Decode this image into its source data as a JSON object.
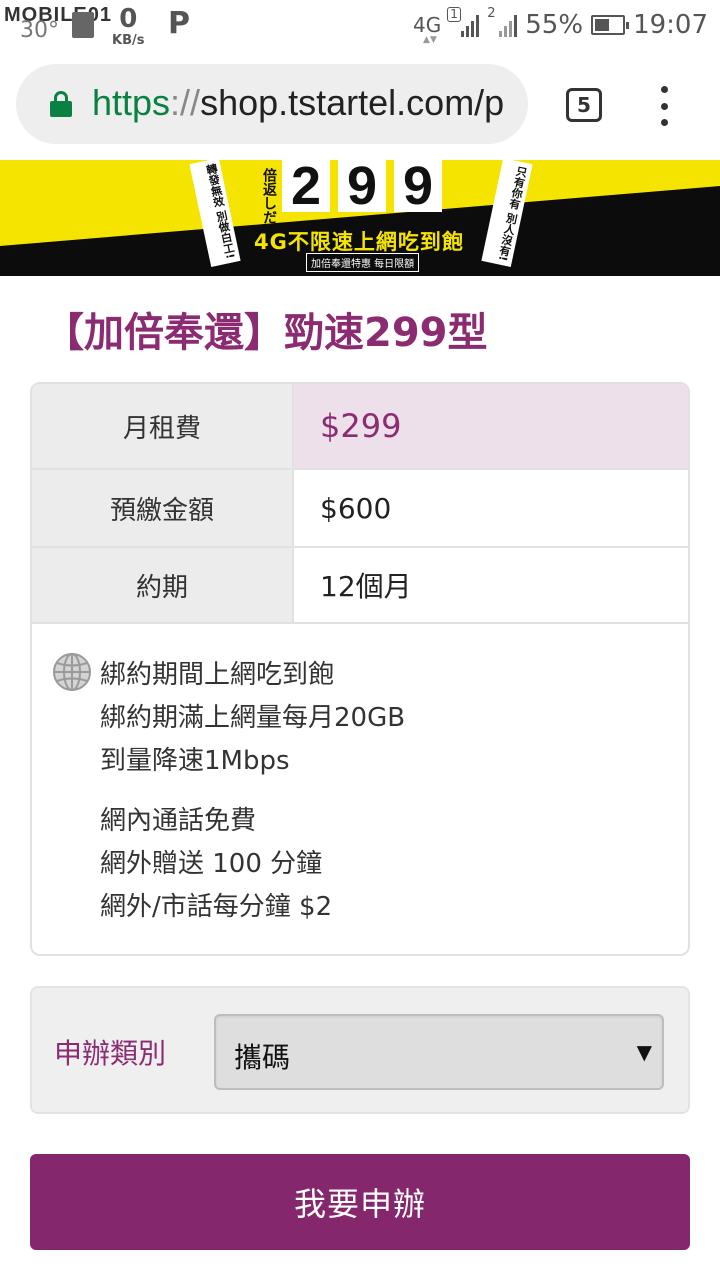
{
  "status_bar": {
    "watermark": "MOBILE01",
    "temperature": "30°",
    "speed_value": "0",
    "speed_unit": "KB/s",
    "parking_glyph": "P",
    "network_type": "4G",
    "sim1_label": "1",
    "sim2_label": "2",
    "battery_percent": "55%",
    "battery_level": 0.55,
    "time": "19:07",
    "icons": [
      "image-icon",
      "parking-icon",
      "sim1-signal-icon",
      "sim2-signal-icon",
      "battery-icon"
    ]
  },
  "browser": {
    "url_scheme": "https",
    "url_separator": "://",
    "url_rest": "shop.tstartel.com/p",
    "tab_count": "5",
    "icons": [
      "lock-icon",
      "tabs-icon",
      "overflow-menu-icon"
    ],
    "secure_color": "#0b8043"
  },
  "banner": {
    "price_digits": [
      "2",
      "9",
      "9"
    ],
    "tag": "倍返しだ",
    "slogan": "4G不限速上網吃到飽",
    "small_note": "加倍奉還特惠 每日限額",
    "left_ribbon": "轉發無效 別做白工!",
    "right_ribbon": "只有你有 別人沒有!",
    "colors": {
      "yellow": "#f5e400",
      "black": "#0c0c0c"
    }
  },
  "plan": {
    "title": "【加倍奉還】勁速299型",
    "title_color": "#8b2c73",
    "rows": [
      {
        "label": "月租費",
        "value": "$299",
        "highlight": true
      },
      {
        "label": "預繳金額",
        "value": "$600",
        "highlight": false
      },
      {
        "label": "約期",
        "value": "12個月",
        "highlight": false
      }
    ],
    "features_data": [
      "綁約期間上網吃到飽",
      "綁約期滿上網量每月20GB",
      "到量降速1Mbps"
    ],
    "features_voice": [
      "網內通話免費",
      "網外贈送 100 分鐘",
      "網外/市話每分鐘 $2"
    ],
    "feature_icon": "globe-icon"
  },
  "apply": {
    "label": "申辦類別",
    "selected": "攜碼",
    "caret_icon": "caret-down-icon"
  },
  "submit": {
    "label": "我要申辦",
    "color": "#85276c"
  }
}
